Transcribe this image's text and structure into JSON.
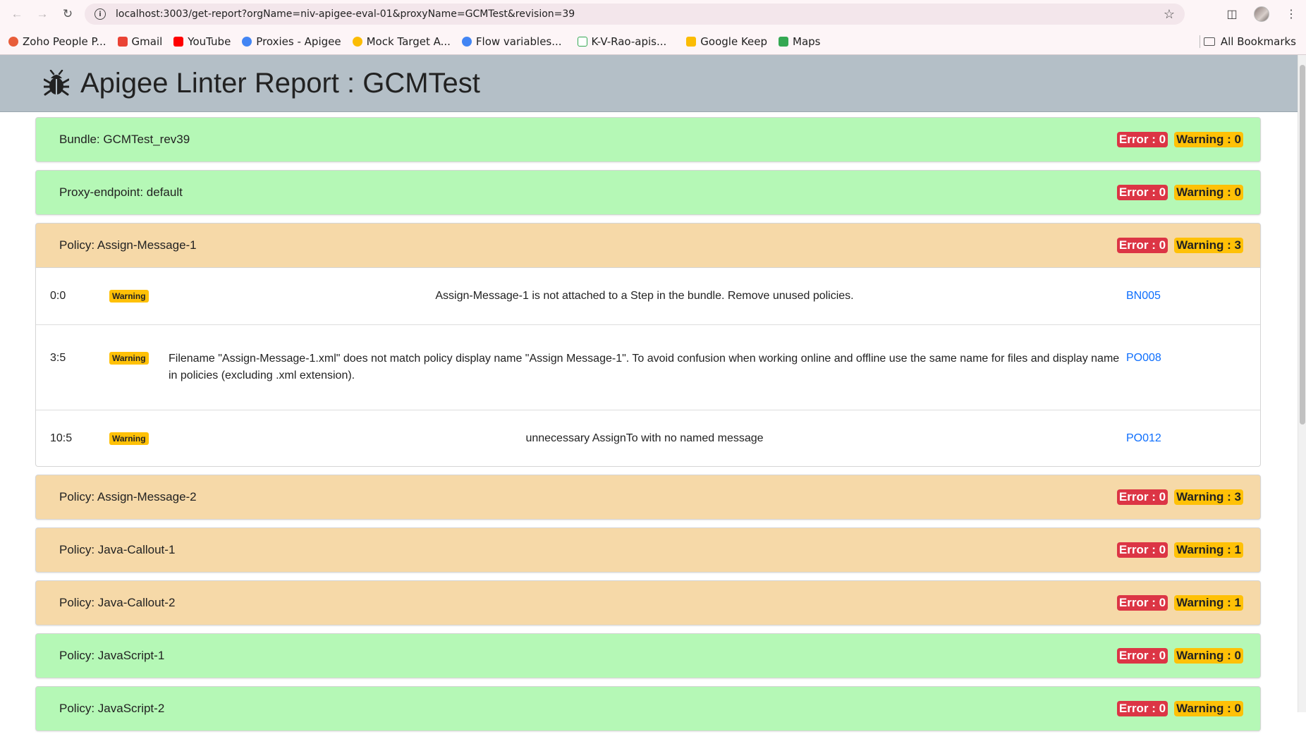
{
  "browser": {
    "url": "localhost:3003/get-report?orgName=niv-apigee-eval-01&proxyName=GCMTest&revision=39",
    "bookmarks": [
      {
        "label": "Zoho People P...",
        "color": "#e85d3a"
      },
      {
        "label": "Gmail",
        "color": "#ea4335"
      },
      {
        "label": "YouTube",
        "color": "#ff0000"
      },
      {
        "label": "Proxies - Apigee",
        "color": "#4285f4"
      },
      {
        "label": "Mock Target A...",
        "color": "#fbbc04"
      },
      {
        "label": "Flow variables...",
        "color": "#4285f4"
      },
      {
        "label": "K-V-Rao-apis...",
        "color": "#34a853"
      },
      {
        "label": "Google Keep",
        "color": "#fbbc04"
      },
      {
        "label": "Maps",
        "color": "#34a853"
      }
    ],
    "all_bookmarks": "All Bookmarks"
  },
  "header": {
    "title": "Apigee Linter Report : GCMTest",
    "icon": "bug-icon"
  },
  "items": [
    {
      "title": "Bundle: GCMTest_rev39",
      "error": "Error : 0",
      "warning": "Warning : 0",
      "status": "ok"
    },
    {
      "title": "Proxy-endpoint: default",
      "error": "Error : 0",
      "warning": "Warning : 0",
      "status": "ok"
    },
    {
      "title": "Policy: Assign-Message-1",
      "error": "Error : 0",
      "warning": "Warning : 3",
      "status": "warn"
    },
    {
      "title": "Policy: Assign-Message-2",
      "error": "Error : 0",
      "warning": "Warning : 3",
      "status": "warn"
    },
    {
      "title": "Policy: Java-Callout-1",
      "error": "Error : 0",
      "warning": "Warning : 1",
      "status": "warn"
    },
    {
      "title": "Policy: Java-Callout-2",
      "error": "Error : 0",
      "warning": "Warning : 1",
      "status": "warn"
    },
    {
      "title": "Policy: JavaScript-1",
      "error": "Error : 0",
      "warning": "Warning : 0",
      "status": "ok"
    },
    {
      "title": "Policy: JavaScript-2",
      "error": "Error : 0",
      "warning": "Warning : 0",
      "status": "ok"
    }
  ],
  "details": [
    {
      "position": "0:0",
      "level": "Warning",
      "message": "Assign-Message-1 is not attached to a Step in the bundle. Remove unused policies.",
      "code": "BN005"
    },
    {
      "position": "3:5",
      "level": "Warning",
      "message": "Filename \"Assign-Message-1.xml\" does not match policy display name \"Assign Message-1\". To avoid confusion when working online and offline use the same name for files and display name in policies (excluding .xml extension).",
      "code": "PO008"
    },
    {
      "position": "10:5",
      "level": "Warning",
      "message": "unnecessary AssignTo with no named message",
      "code": "PO012"
    }
  ],
  "colors": {
    "ok_bg": "#b5f8b6",
    "warn_bg": "#f6d9a8",
    "error_badge": "#dc3545",
    "warning_badge": "#ffc107",
    "link": "#0d6efd"
  }
}
